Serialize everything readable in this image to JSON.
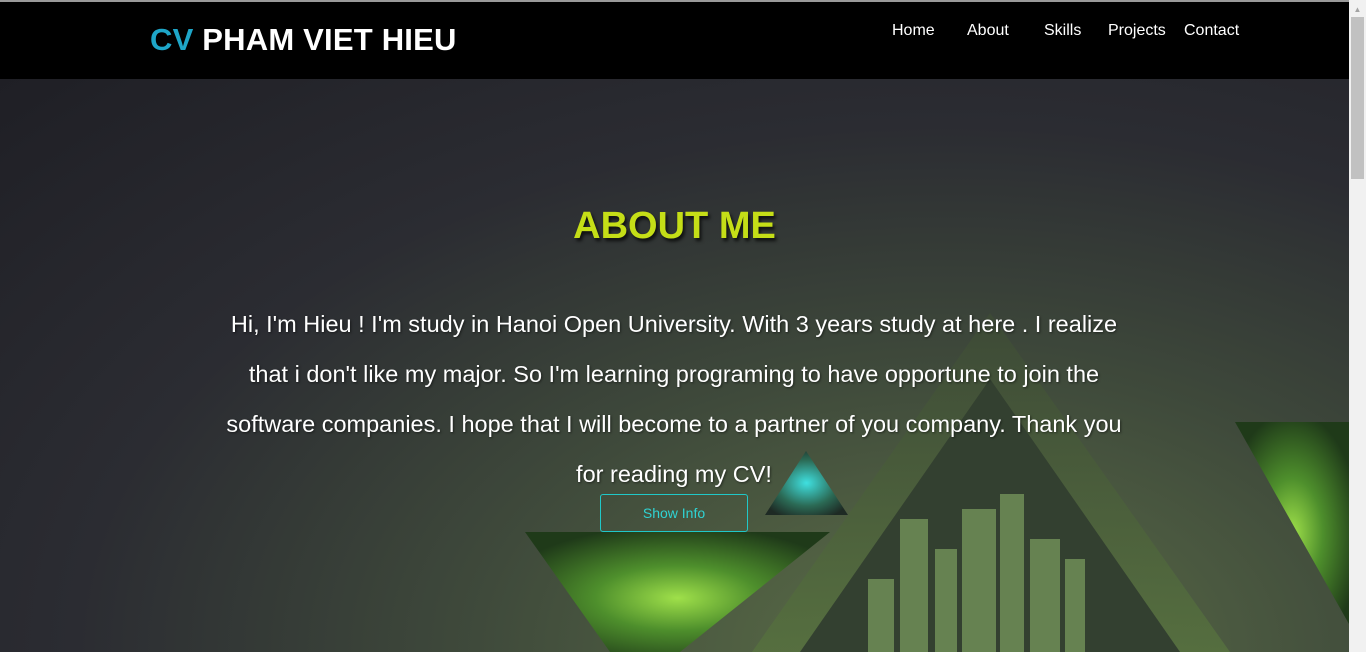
{
  "header": {
    "brand_accent": "CV",
    "brand_name": "PHAM VIET HIEU",
    "nav": [
      {
        "label": "Home"
      },
      {
        "label": "About"
      },
      {
        "label": "Skills"
      },
      {
        "label": "Projects"
      },
      {
        "label": "Contact"
      }
    ]
  },
  "about": {
    "title": "ABOUT ME",
    "paragraph": "Hi, I'm Hieu ! I'm study in Hanoi Open University. With 3 years study at here . I realize that i don't like my major. So I'm learning programing to have opportune to join the software companies. I hope that I will become to a partner of you company. Thank you for reading my CV!",
    "button_label": "Show Info"
  },
  "colors": {
    "accent_blue": "#1ea6c8",
    "title_green": "#c5de17",
    "button_cyan": "#20c8c8",
    "navbar_bg": "#000000"
  },
  "icons": {
    "scroll_up": "scroll-up-arrow-icon"
  }
}
